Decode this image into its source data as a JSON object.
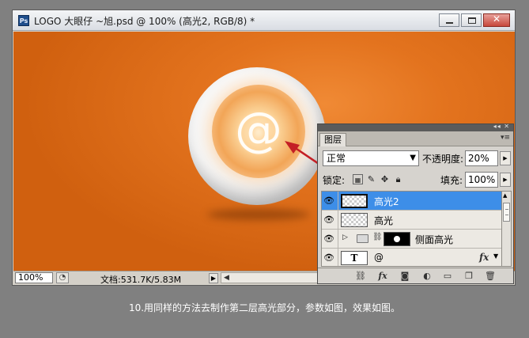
{
  "window": {
    "app_icon": "Ps",
    "title": "LOGO 大眼仔 ~旭.psd @ 100% (高光2, RGB/8) *"
  },
  "canvas": {
    "glyph": "@",
    "background_color": "#e3731e"
  },
  "status": {
    "zoom": "100%",
    "doc_info": "文档:531.7K/5.83M",
    "play_glyph": "▶",
    "scroll_left_glyph": "◀"
  },
  "layers_panel": {
    "tab": "图层",
    "blend_mode": "正常",
    "opacity_label": "不透明度:",
    "opacity_value": "20%",
    "lock_label": "锁定:",
    "fill_label": "填充:",
    "fill_value": "100%",
    "layers": [
      {
        "name": "高光2",
        "selected": true
      },
      {
        "name": "高光",
        "selected": false
      },
      {
        "name": "侧面高光",
        "type": "group"
      },
      {
        "name": "@",
        "type": "text",
        "fx": "fx"
      }
    ]
  },
  "caption": "10.用同样的方法去制作第二层高光部分，参数如图，效果如图。",
  "colors": {
    "selected_layer": "#3d8ee8",
    "arrow": "#c41f25",
    "page_background": "#808080"
  }
}
